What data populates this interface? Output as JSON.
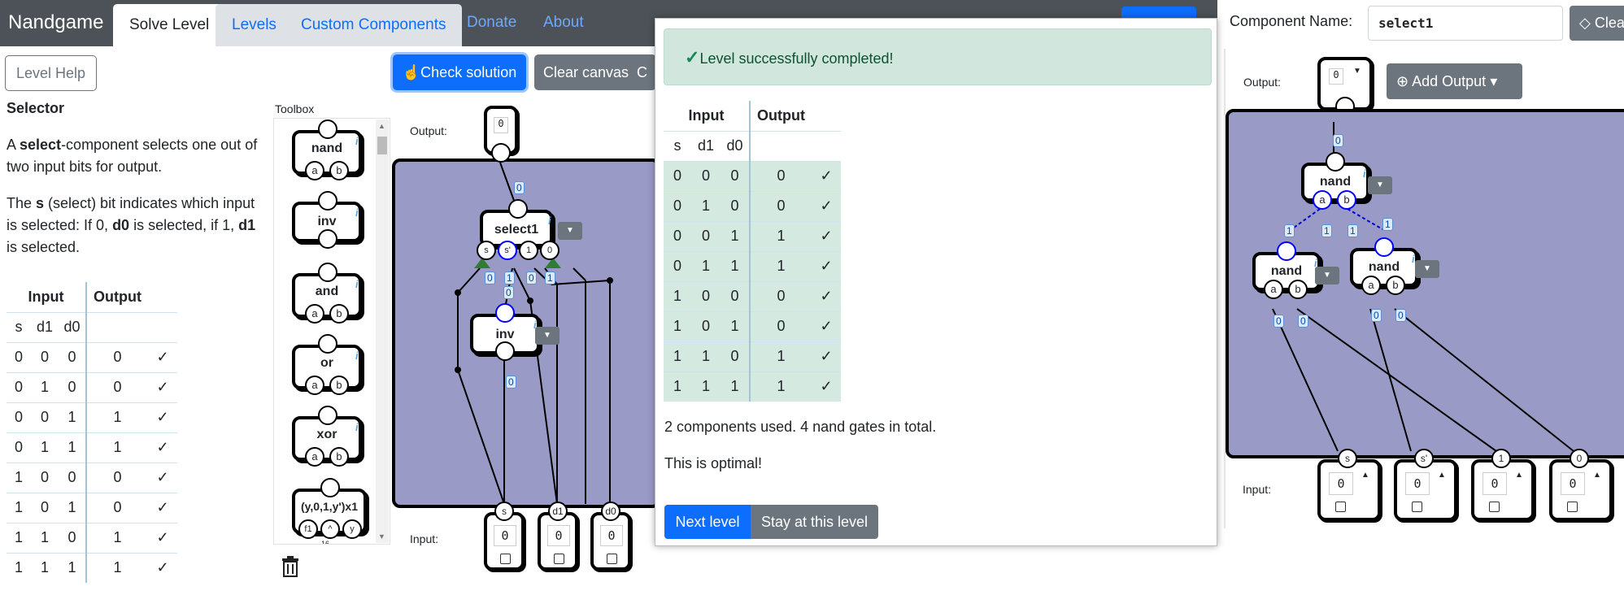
{
  "nav": {
    "brand": "Nandgame",
    "tabs": [
      "Solve Level",
      "Levels",
      "Custom Components"
    ],
    "links": [
      "Donate",
      "About"
    ]
  },
  "level": {
    "help_button": "Level Help",
    "title": "Selector",
    "desc1_pre": "A ",
    "desc1_bold": "select",
    "desc1_post": "-component selects one out of two input bits for output.",
    "desc2_a": "The ",
    "desc2_b": "s",
    "desc2_c": " (select) bit indicates which input is selected: If 0, ",
    "desc2_d": "d0",
    "desc2_e": " is selected, if 1, ",
    "desc2_f": "d1",
    "desc2_g": " is selected."
  },
  "truth_table": {
    "group_input": "Input",
    "group_output": "Output",
    "columns": [
      "s",
      "d1",
      "d0"
    ],
    "rows": [
      [
        "0",
        "0",
        "0",
        "0"
      ],
      [
        "0",
        "1",
        "0",
        "0"
      ],
      [
        "0",
        "0",
        "1",
        "1"
      ],
      [
        "0",
        "1",
        "1",
        "1"
      ],
      [
        "1",
        "0",
        "0",
        "0"
      ],
      [
        "1",
        "0",
        "1",
        "0"
      ],
      [
        "1",
        "1",
        "0",
        "1"
      ],
      [
        "1",
        "1",
        "1",
        "1"
      ]
    ],
    "check": "✓"
  },
  "toolbox": {
    "label": "Toolbox",
    "items": [
      {
        "name": "nand",
        "pins": [
          "a",
          "b"
        ]
      },
      {
        "name": "inv",
        "pins": []
      },
      {
        "name": "and",
        "pins": [
          "a",
          "b"
        ]
      },
      {
        "name": "or",
        "pins": [
          "a",
          "b"
        ]
      },
      {
        "name": "xor",
        "pins": [
          "a",
          "b"
        ]
      },
      {
        "name": "(y,0,1,y')x1",
        "pins": [
          "f1",
          "^",
          "y"
        ]
      }
    ],
    "extra_number": "16",
    "info_glyph": "i"
  },
  "toolbar": {
    "check_solution": "Check solution",
    "clear_canvas": "Clear canvas",
    "cut_glyph": "C"
  },
  "canvas": {
    "output_label": "Output:",
    "input_label": "Input:",
    "output_value": "0",
    "component_name": "select1",
    "component_pins": [
      "s",
      "s'",
      "1",
      "0"
    ],
    "inv_label": "inv",
    "inputs": [
      {
        "name": "s",
        "value": "0"
      },
      {
        "name": "d1",
        "value": "0"
      },
      {
        "name": "d0",
        "value": "0"
      }
    ],
    "wire_values": [
      "0",
      "0",
      "1",
      "0",
      "0",
      "1",
      "0"
    ]
  },
  "modal": {
    "alert": "Level successfully completed!",
    "usage": "2 components used. 4 nand gates in total.",
    "optimal": "This is optimal!",
    "next_level": "Next level",
    "stay": "Stay at this level"
  },
  "custom": {
    "name_label": "Component Name:",
    "name_value": "select1",
    "clear_label": "Clea",
    "output_label": "Output:",
    "output_value": "0",
    "add_output": "Add Output",
    "input_label": "Input:",
    "top_gate": "nand",
    "left_gate": "nand",
    "right_gate": "nand",
    "pin_a": "a",
    "pin_b": "b",
    "inputs": [
      {
        "name": "s",
        "value": "0"
      },
      {
        "name": "s'",
        "value": "0"
      },
      {
        "name": "1",
        "value": "0"
      },
      {
        "name": "0",
        "value": "0"
      }
    ],
    "wire_values": [
      "0",
      "1",
      "1",
      "1",
      "1",
      "0",
      "0",
      "0",
      "0"
    ]
  }
}
